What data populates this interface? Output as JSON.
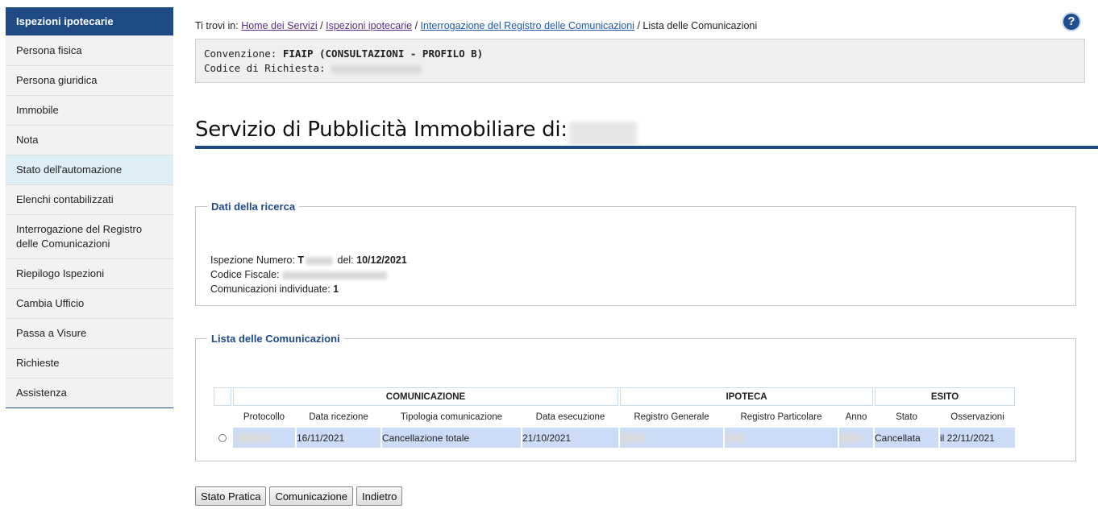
{
  "sidebar": {
    "header": "Ispezioni ipotecarie",
    "items": [
      {
        "label": "Persona fisica"
      },
      {
        "label": "Persona giuridica"
      },
      {
        "label": "Immobile"
      },
      {
        "label": "Nota"
      },
      {
        "label": "Stato dell'automazione"
      },
      {
        "label": "Elenchi contabilizzati"
      },
      {
        "label": "Interrogazione del Registro delle Comunicazioni"
      },
      {
        "label": "Riepilogo Ispezioni"
      },
      {
        "label": "Cambia Ufficio"
      },
      {
        "label": "Passa a Visure"
      },
      {
        "label": "Richieste"
      },
      {
        "label": "Assistenza"
      }
    ]
  },
  "breadcrumb": {
    "prefix": "Ti trovi in: ",
    "links": [
      "Home dei Servizi",
      "Ispezioni ipotecarie",
      "Interrogazione del Registro delle Comunicazioni"
    ],
    "separator": " / ",
    "current": "Lista delle Comunicazioni"
  },
  "help": {
    "icon": "help-icon",
    "glyph": "?"
  },
  "convenzione": {
    "label": "Convenzione: ",
    "value": "FIAIP (CONSULTAZIONI - PROFILO B)",
    "codice_label": "Codice di Richiesta: "
  },
  "page_title": "Servizio di Pubblicità Immobiliare di:",
  "ricerca": {
    "legend": "Dati della ricerca",
    "ispezione_label": "Ispezione Numero: ",
    "ispezione_prefix": "T",
    "del_label": " del: ",
    "del_value": "10/12/2021",
    "codice_fiscale_label": "Codice Fiscale: ",
    "comunicazioni_label": "Comunicazioni individuate: ",
    "comunicazioni_value": "1"
  },
  "lista": {
    "legend": "Lista delle Comunicazioni",
    "groups": [
      "COMUNICAZIONE",
      "IPOTECA",
      "ESITO"
    ],
    "columns": [
      "Protocollo",
      "Data ricezione",
      "Tipologia comunicazione",
      "Data esecuzione",
      "Registro Generale",
      "Registro Particolare",
      "Anno",
      "Stato",
      "Osservazioni"
    ],
    "rows": [
      {
        "protocollo": "",
        "data_ricezione": "16/11/2021",
        "tipologia": "Cancellazione totale",
        "data_esecuzione": "21/10/2021",
        "registro_generale": "",
        "registro_particolare": "",
        "anno": "",
        "stato": "Cancellata",
        "osservazioni": "il 22/11/2021"
      }
    ]
  },
  "buttons": {
    "stato_pratica": "Stato Pratica",
    "comunicazione": "Comunicazione",
    "indietro": "Indietro"
  }
}
